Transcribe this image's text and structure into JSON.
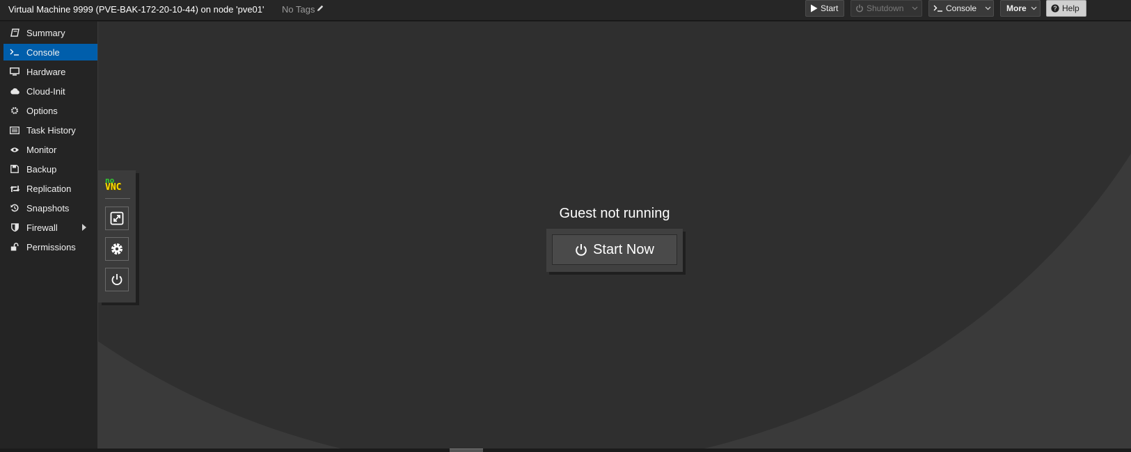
{
  "header": {
    "title": "Virtual Machine 9999 (PVE-BAK-172-20-10-44) on node 'pve01'",
    "tags_label": "No Tags",
    "buttons": {
      "start": "Start",
      "shutdown": "Shutdown",
      "console": "Console",
      "more": "More",
      "help": "Help"
    }
  },
  "sidebar": {
    "items": [
      {
        "label": "Summary",
        "icon": "book-icon"
      },
      {
        "label": "Console",
        "icon": "terminal-icon",
        "active": true
      },
      {
        "label": "Hardware",
        "icon": "monitor-icon"
      },
      {
        "label": "Cloud-Init",
        "icon": "cloud-icon"
      },
      {
        "label": "Options",
        "icon": "gear-icon"
      },
      {
        "label": "Task History",
        "icon": "list-icon"
      },
      {
        "label": "Monitor",
        "icon": "eye-icon"
      },
      {
        "label": "Backup",
        "icon": "floppy-icon"
      },
      {
        "label": "Replication",
        "icon": "retweet-icon"
      },
      {
        "label": "Snapshots",
        "icon": "history-icon"
      },
      {
        "label": "Firewall",
        "icon": "shield-icon"
      },
      {
        "label": "Permissions",
        "icon": "unlock-icon"
      }
    ]
  },
  "console": {
    "status": "Guest not running",
    "start_now": "Start Now"
  },
  "vnc": {
    "logo_no": "no",
    "logo_vnc": "VNC"
  },
  "colors": {
    "active": "#005eab",
    "background": "#2f2f2f",
    "header": "#262626"
  }
}
